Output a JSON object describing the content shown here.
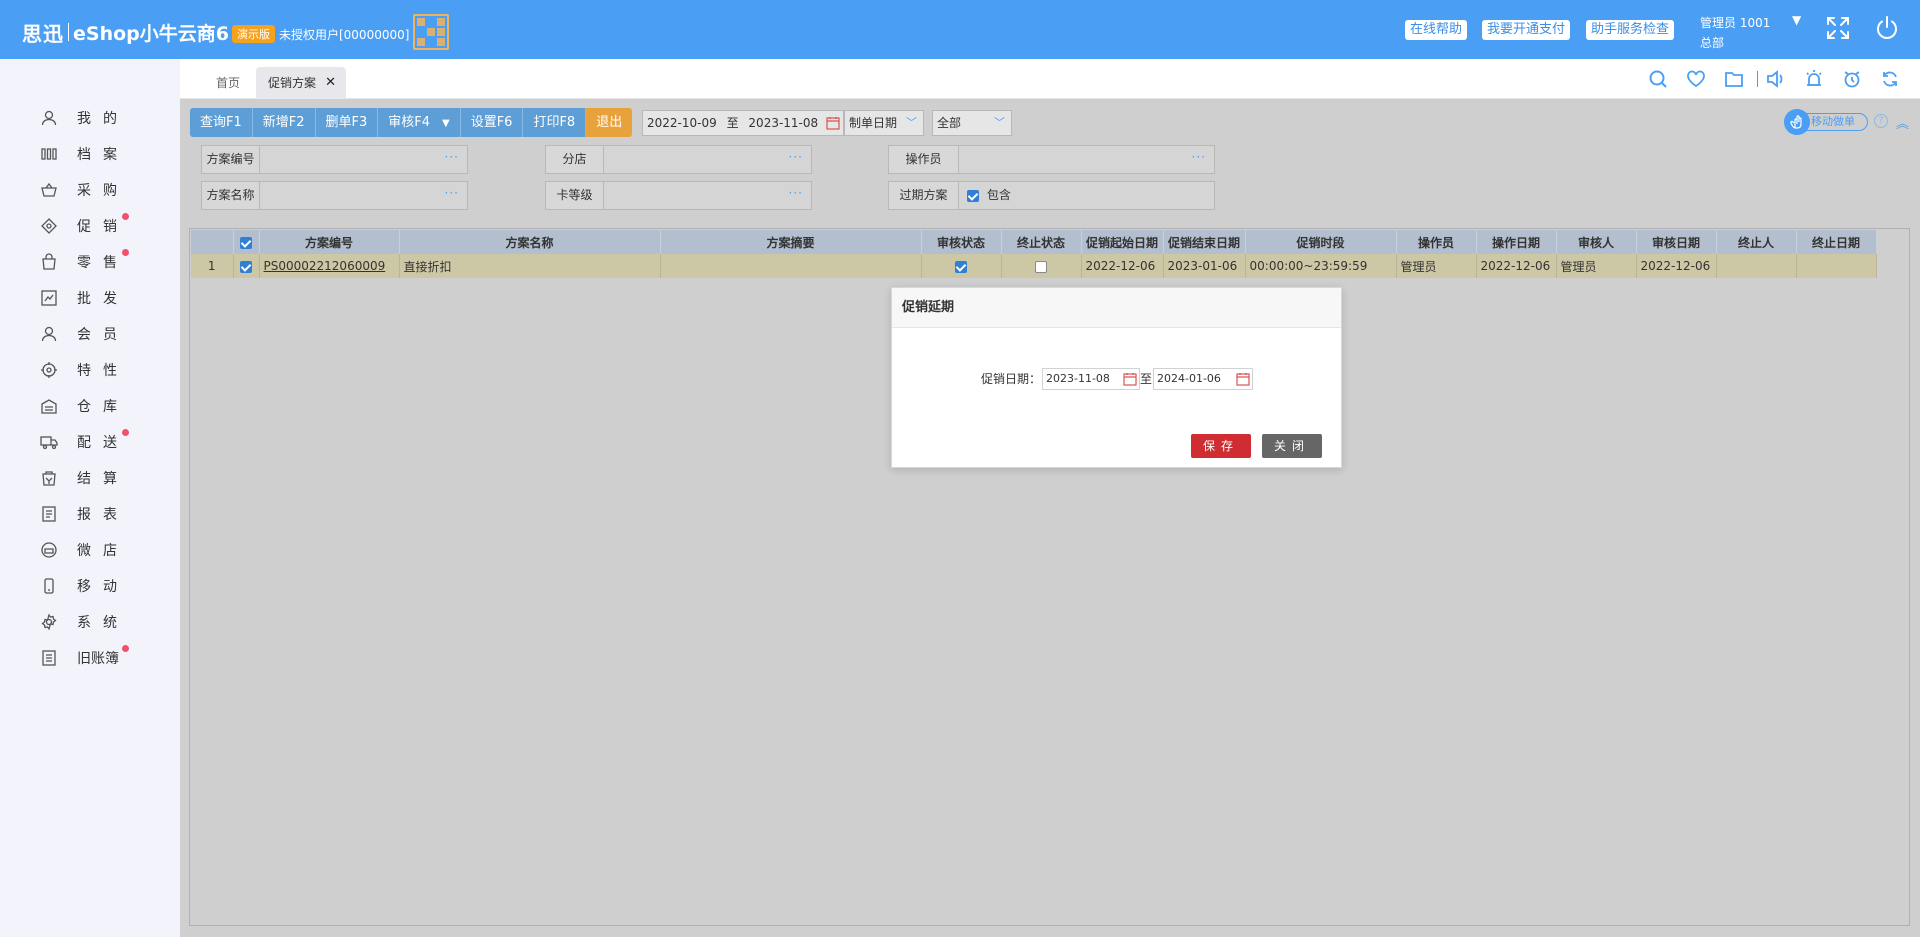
{
  "header": {
    "brand_cn": "思迅",
    "brand_product": "eShop小牛云商6",
    "demo_badge": "演示版",
    "license_text": "未授权用户[00000000]",
    "links": [
      "在线帮助",
      "我要开通支付",
      "助手服务检查"
    ],
    "user_name": "管理员 1001",
    "user_branch": "总部"
  },
  "sidebar": {
    "items": [
      {
        "label": "我的",
        "icon": "user-icon",
        "dot": false
      },
      {
        "label": "档案",
        "icon": "archive-icon",
        "dot": false
      },
      {
        "label": "采购",
        "icon": "basket-icon",
        "dot": false
      },
      {
        "label": "促销",
        "icon": "tag-icon",
        "dot": true
      },
      {
        "label": "零售",
        "icon": "shopping-bag-icon",
        "dot": true
      },
      {
        "label": "批发",
        "icon": "wholesale-icon",
        "dot": false
      },
      {
        "label": "会员",
        "icon": "member-icon",
        "dot": false
      },
      {
        "label": "特性",
        "icon": "feature-icon",
        "dot": false
      },
      {
        "label": "仓库",
        "icon": "warehouse-icon",
        "dot": false
      },
      {
        "label": "配送",
        "icon": "truck-icon",
        "dot": true
      },
      {
        "label": "结算",
        "icon": "settlement-icon",
        "dot": false
      },
      {
        "label": "报表",
        "icon": "report-icon",
        "dot": false
      },
      {
        "label": "微店",
        "icon": "micro-shop-icon",
        "dot": false
      },
      {
        "label": "移动",
        "icon": "mobile-icon",
        "dot": false
      },
      {
        "label": "系统",
        "icon": "gear-icon",
        "dot": false
      },
      {
        "label": "旧账簿",
        "icon": "ledger-icon",
        "dot": true
      }
    ]
  },
  "tabs": {
    "home": "首页",
    "active": "促销方案"
  },
  "toolbar": {
    "buttons": [
      "查询F1",
      "新增F2",
      "删单F3",
      "审核F4",
      "设置F6",
      "打印F8",
      "退出"
    ],
    "date_from": "2022-10-09",
    "date_to_sep": "至",
    "date_to": "2023-11-08",
    "date_type": "制单日期",
    "status_filter": "全部",
    "move_order": "移动做单"
  },
  "filters": {
    "plan_no_label": "方案编号",
    "plan_name_label": "方案名称",
    "branch_label": "分店",
    "card_level_label": "卡等级",
    "operator_label": "操作员",
    "expired_label": "过期方案",
    "include_label": "包含"
  },
  "grid": {
    "columns": [
      "",
      "",
      "方案编号",
      "方案名称",
      "方案摘要",
      "审核状态",
      "终止状态",
      "促销起始日期",
      "促销结束日期",
      "促销时段",
      "操作员",
      "操作日期",
      "审核人",
      "审核日期",
      "终止人",
      "终止日期"
    ],
    "rows": [
      {
        "index": "1",
        "plan_no": "PS00002212060009",
        "plan_name": "直接折扣",
        "summary": "",
        "approved": true,
        "terminated": false,
        "start_date": "2022-12-06",
        "end_date": "2023-01-06",
        "time_range": "00:00:00~23:59:59",
        "operator": "管理员",
        "op_date": "2022-12-06",
        "approver": "管理员",
        "approve_date": "2022-12-06",
        "terminator": "",
        "terminate_date": ""
      }
    ]
  },
  "dialog": {
    "title": "促销延期",
    "date_label": "促销日期：",
    "from": "2023-11-08",
    "to_sep": "至",
    "to": "2024-01-06",
    "save": "保存",
    "close": "关闭"
  },
  "colors": {
    "header_bg": "#4a9ff5",
    "toolbar_btn": "#5e9ed6",
    "exit_btn": "#e8a23c",
    "save_btn": "#cf2d31",
    "close_btn": "#666666",
    "nav_dot": "#f2506b"
  }
}
